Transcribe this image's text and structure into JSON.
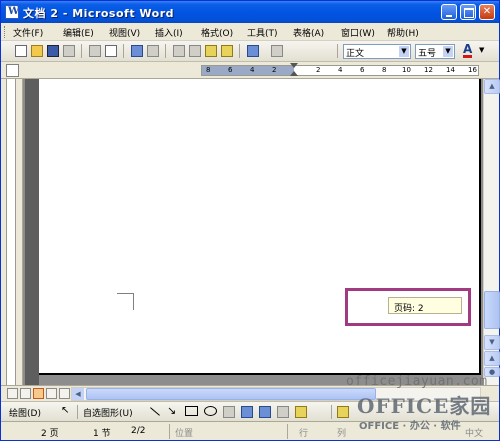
{
  "window": {
    "title": "文档 2 - Microsoft Word"
  },
  "menu": [
    {
      "label": "文件(F)"
    },
    {
      "label": "编辑(E)"
    },
    {
      "label": "视图(V)"
    },
    {
      "label": "插入(I)"
    },
    {
      "label": "格式(O)"
    },
    {
      "label": "工具(T)"
    },
    {
      "label": "表格(A)"
    },
    {
      "label": "窗口(W)"
    },
    {
      "label": "帮助(H)"
    }
  ],
  "toolbar": {
    "style_value": "正文",
    "size_value": "五号",
    "font_color_label": "A"
  },
  "ruler": {
    "numbers": [
      "8",
      "6",
      "4",
      "2",
      "2",
      "4",
      "6",
      "8",
      "10",
      "12",
      "14",
      "16"
    ]
  },
  "document": {
    "page_number_field": "页码: 2"
  },
  "drawing_toolbar": {
    "draw_label": "绘图(D)",
    "autoshapes_label": "自选图形(U)"
  },
  "status": {
    "page": "2 页",
    "section": "1 节",
    "page_of": "2/2",
    "position": "位置",
    "line": "行",
    "column": "列",
    "language": "中文"
  },
  "watermark": {
    "url": "officejiayuan.com",
    "brand": "OFFICE家园",
    "tagline": "OFFICE · 办公 · 软件"
  }
}
